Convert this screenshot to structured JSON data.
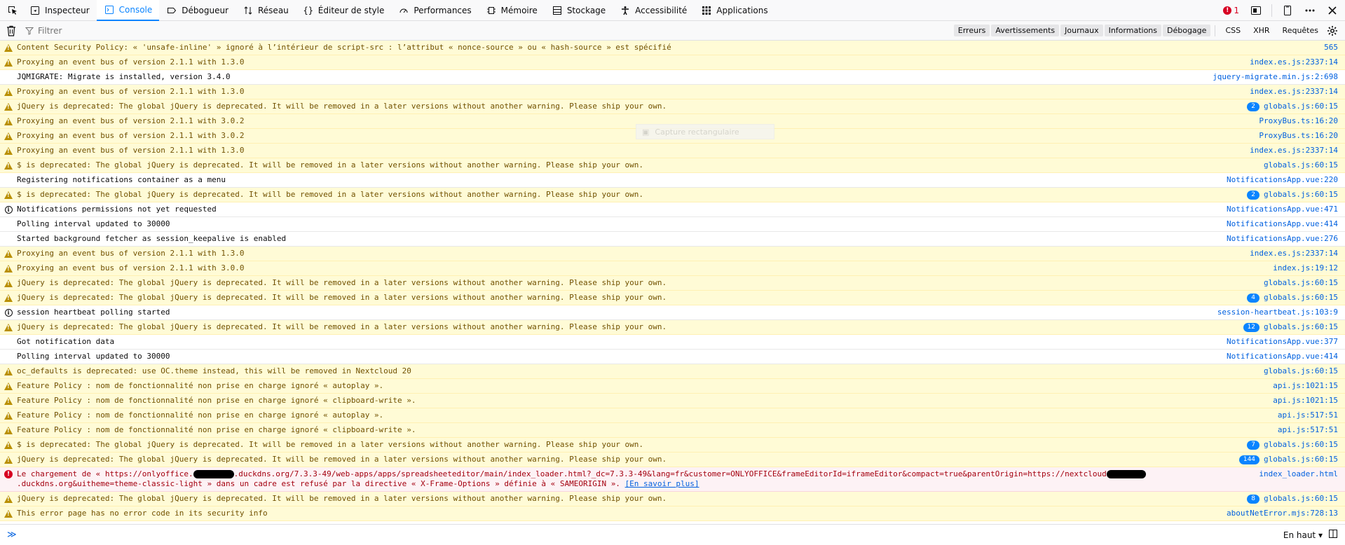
{
  "toolbar": {
    "tabs": [
      {
        "label": "Inspecteur",
        "icon": "inspector-icon"
      },
      {
        "label": "Console",
        "icon": "console-icon"
      },
      {
        "label": "Débogueur",
        "icon": "debugger-icon"
      },
      {
        "label": "Réseau",
        "icon": "network-icon"
      },
      {
        "label": "Éditeur de style",
        "icon": "style-editor-icon"
      },
      {
        "label": "Performances",
        "icon": "performance-icon"
      },
      {
        "label": "Mémoire",
        "icon": "memory-icon"
      },
      {
        "label": "Stockage",
        "icon": "storage-icon"
      },
      {
        "label": "Accessibilité",
        "icon": "accessibility-icon"
      },
      {
        "label": "Applications",
        "icon": "applications-icon"
      }
    ],
    "active_tab": "Console",
    "error_count": "1"
  },
  "filterbar": {
    "placeholder": "Filtrer",
    "buttons": [
      "Erreurs",
      "Avertissements",
      "Journaux",
      "Informations",
      "Débogage"
    ],
    "extra": [
      "CSS",
      "XHR",
      "Requêtes"
    ]
  },
  "messages": [
    {
      "type": "warn",
      "text": "Content Security Policy: « 'unsafe-inline' » ignoré à l’intérieur de script-src : l’attribut « nonce-source » ou « hash-source » est spécifié",
      "source": "565"
    },
    {
      "type": "warn",
      "text": "Proxying an event bus of version 2.1.1 with 1.3.0",
      "source": "index.es.js:2337:14"
    },
    {
      "type": "log",
      "text": "JQMIGRATE: Migrate is installed, version 3.4.0",
      "source": "jquery-migrate.min.js:2:698"
    },
    {
      "type": "warn",
      "text": "Proxying an event bus of version 2.1.1 with 1.3.0",
      "source": "index.es.js:2337:14"
    },
    {
      "type": "warn",
      "text": "jQuery is deprecated: The global jQuery is deprecated. It will be removed in a later versions without another warning. Please ship your own.",
      "badge": "2",
      "source": "globals.js:60:15"
    },
    {
      "type": "warn",
      "text": "Proxying an event bus of version 2.1.1 with 3.0.2",
      "source": "ProxyBus.ts:16:20"
    },
    {
      "type": "warn",
      "text": "Proxying an event bus of version 2.1.1 with 3.0.2",
      "source": "ProxyBus.ts:16:20"
    },
    {
      "type": "warn",
      "text": "Proxying an event bus of version 2.1.1 with 1.3.0",
      "source": "index.es.js:2337:14"
    },
    {
      "type": "warn",
      "text": "$ is deprecated: The global jQuery is deprecated. It will be removed in a later versions without another warning. Please ship your own.",
      "source": "globals.js:60:15"
    },
    {
      "type": "log",
      "text": "Registering notifications container as a menu",
      "source": "NotificationsApp.vue:220"
    },
    {
      "type": "warn",
      "text": "$ is deprecated: The global jQuery is deprecated. It will be removed in a later versions without another warning. Please ship your own.",
      "badge": "2",
      "source": "globals.js:60:15"
    },
    {
      "type": "info",
      "text": "Notifications permissions not yet requested",
      "source": "NotificationsApp.vue:471"
    },
    {
      "type": "log",
      "text": "Polling interval updated to 30000",
      "source": "NotificationsApp.vue:414"
    },
    {
      "type": "log",
      "text": "Started background fetcher as session_keepalive is enabled",
      "source": "NotificationsApp.vue:276"
    },
    {
      "type": "warn",
      "text": "Proxying an event bus of version 2.1.1 with 1.3.0",
      "source": "index.es.js:2337:14"
    },
    {
      "type": "warn",
      "text": "Proxying an event bus of version 2.1.1 with 3.0.0",
      "source": "index.js:19:12"
    },
    {
      "type": "warn",
      "text": "jQuery is deprecated: The global jQuery is deprecated. It will be removed in a later versions without another warning. Please ship your own.",
      "source": "globals.js:60:15"
    },
    {
      "type": "warn",
      "text": "jQuery is deprecated: The global jQuery is deprecated. It will be removed in a later versions without another warning. Please ship your own.",
      "badge": "4",
      "source": "globals.js:60:15"
    },
    {
      "type": "info",
      "text": "session heartbeat polling started",
      "source": "session-heartbeat.js:103:9"
    },
    {
      "type": "warn",
      "text": "jQuery is deprecated: The global jQuery is deprecated. It will be removed in a later versions without another warning. Please ship your own.",
      "badge": "12",
      "source": "globals.js:60:15"
    },
    {
      "type": "log",
      "text": "Got notification data",
      "source": "NotificationsApp.vue:377"
    },
    {
      "type": "log",
      "text": "Polling interval updated to 30000",
      "source": "NotificationsApp.vue:414"
    },
    {
      "type": "warn",
      "text": "oc_defaults is deprecated: use OC.theme instead, this will be removed in Nextcloud 20",
      "source": "globals.js:60:15"
    },
    {
      "type": "warn",
      "text": "Feature Policy : nom de fonctionnalité non prise en charge ignoré « autoplay ».",
      "source": "api.js:1021:15"
    },
    {
      "type": "warn",
      "text": "Feature Policy : nom de fonctionnalité non prise en charge ignoré « clipboard-write ».",
      "source": "api.js:1021:15"
    },
    {
      "type": "warn",
      "text": "Feature Policy : nom de fonctionnalité non prise en charge ignoré « autoplay ».",
      "source": "api.js:517:51"
    },
    {
      "type": "warn",
      "text": "Feature Policy : nom de fonctionnalité non prise en charge ignoré « clipboard-write ».",
      "source": "api.js:517:51"
    },
    {
      "type": "warn",
      "text": "$ is deprecated: The global jQuery is deprecated. It will be removed in a later versions without another warning. Please ship your own.",
      "badge": "7",
      "source": "globals.js:60:15"
    },
    {
      "type": "warn",
      "text": "jQuery is deprecated: The global jQuery is deprecated. It will be removed in a later versions without another warning. Please ship your own.",
      "badge": "144",
      "source": "globals.js:60:15"
    },
    {
      "type": "error",
      "parts": [
        "Le chargement de « https://onlyoffice.",
        "REDACT",
        ".duckdns.org/7.3.3-49/web-apps/apps/spreadsheeteditor/main/index_loader.html?_dc=7.3.3-49&lang=fr&customer=ONLYOFFICE&frameEditorId=iframeEditor&compact=true&parentOrigin=https://nextcloud",
        "REDACT",
        ".duckdns.org&uitheme=theme-classic-light » dans un cadre est refusé par la directive « X-Frame-Options » définie à « SAMEORIGIN ». "
      ],
      "link": "[En savoir plus]",
      "source": "index_loader.html"
    },
    {
      "type": "warn",
      "text": "jQuery is deprecated: The global jQuery is deprecated. It will be removed in a later versions without another warning. Please ship your own.",
      "badge": "8",
      "source": "globals.js:60:15"
    },
    {
      "type": "warn",
      "text": "This error page has no error code in its security info",
      "source": "aboutNetError.mjs:728:13"
    }
  ],
  "overlay": {
    "capture_label": "Capture rectangulaire"
  },
  "bottombar": {
    "prompt": "≫",
    "position_label": "En haut"
  }
}
